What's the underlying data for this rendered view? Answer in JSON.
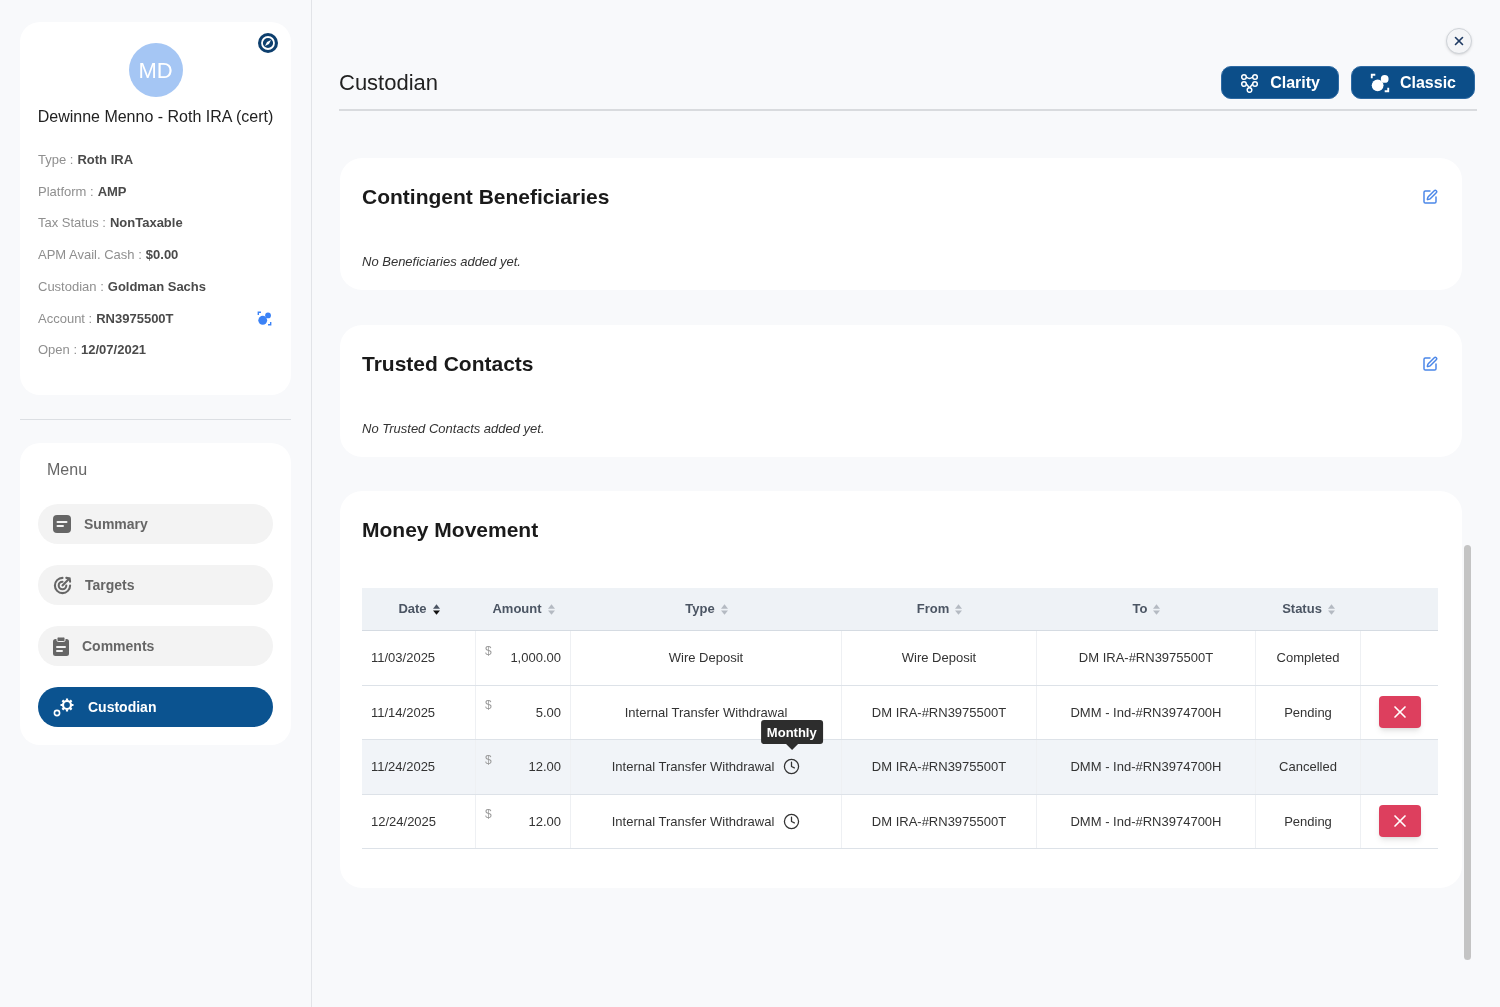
{
  "profile": {
    "initials": "MD",
    "name": "Dewinne Menno - Roth IRA (cert)",
    "fields": [
      {
        "label": "Type :",
        "value": "Roth IRA",
        "action": false
      },
      {
        "label": "Platform :",
        "value": "AMP",
        "action": false
      },
      {
        "label": "Tax Status :",
        "value": "NonTaxable",
        "action": false
      },
      {
        "label": "APM Avail. Cash :",
        "value": "$0.00",
        "action": false
      },
      {
        "label": "Custodian :",
        "value": "Goldman Sachs",
        "action": false
      },
      {
        "label": "Account :",
        "value": "RN3975500T",
        "action": true
      },
      {
        "label": "Open :",
        "value": "12/07/2021",
        "action": false
      }
    ]
  },
  "menu": {
    "title": "Menu",
    "items": [
      {
        "label": "Summary",
        "selected": false
      },
      {
        "label": "Targets",
        "selected": false
      },
      {
        "label": "Comments",
        "selected": false
      },
      {
        "label": "Custodian",
        "selected": true
      }
    ]
  },
  "header": {
    "title": "Custodian",
    "buttons": [
      {
        "label": "Clarity"
      },
      {
        "label": "Classic"
      }
    ]
  },
  "sections": [
    {
      "title": "Contingent Beneficiaries",
      "empty_message": "No Beneficiaries added yet."
    },
    {
      "title": "Trusted Contacts",
      "empty_message": "No Trusted Contacts added yet."
    }
  ],
  "money_movement": {
    "title": "Money Movement",
    "columns": [
      {
        "label": "Date",
        "sorted": true
      },
      {
        "label": "Amount",
        "sorted": false
      },
      {
        "label": "Type",
        "sorted": false
      },
      {
        "label": "From",
        "sorted": false
      },
      {
        "label": "To",
        "sorted": false
      },
      {
        "label": "Status",
        "sorted": false
      }
    ],
    "rows": [
      {
        "date": "11/03/2025",
        "currency": "$",
        "amount": "1,000.00",
        "type": "Wire Deposit",
        "recurring": false,
        "from": "Wire Deposit",
        "to": "DM IRA-#RN3975500T",
        "status": "Completed",
        "cancelable": false,
        "highlighted": false
      },
      {
        "date": "11/14/2025",
        "currency": "$",
        "amount": "5.00",
        "type": "Internal Transfer Withdrawal",
        "recurring": false,
        "from": "DM IRA-#RN3975500T",
        "to": "DMM - Ind-#RN3974700H",
        "status": "Pending",
        "cancelable": true,
        "highlighted": false
      },
      {
        "date": "11/24/2025",
        "currency": "$",
        "amount": "12.00",
        "type": "Internal Transfer Withdrawal",
        "recurring": true,
        "tooltip": "Monthly",
        "from": "DM IRA-#RN3975500T",
        "to": "DMM - Ind-#RN3974700H",
        "status": "Cancelled",
        "cancelable": false,
        "highlighted": true
      },
      {
        "date": "12/24/2025",
        "currency": "$",
        "amount": "12.00",
        "type": "Internal Transfer Withdrawal",
        "recurring": true,
        "from": "DM IRA-#RN3975500T",
        "to": "DMM - Ind-#RN3974700H",
        "status": "Pending",
        "cancelable": true,
        "highlighted": false
      }
    ]
  }
}
